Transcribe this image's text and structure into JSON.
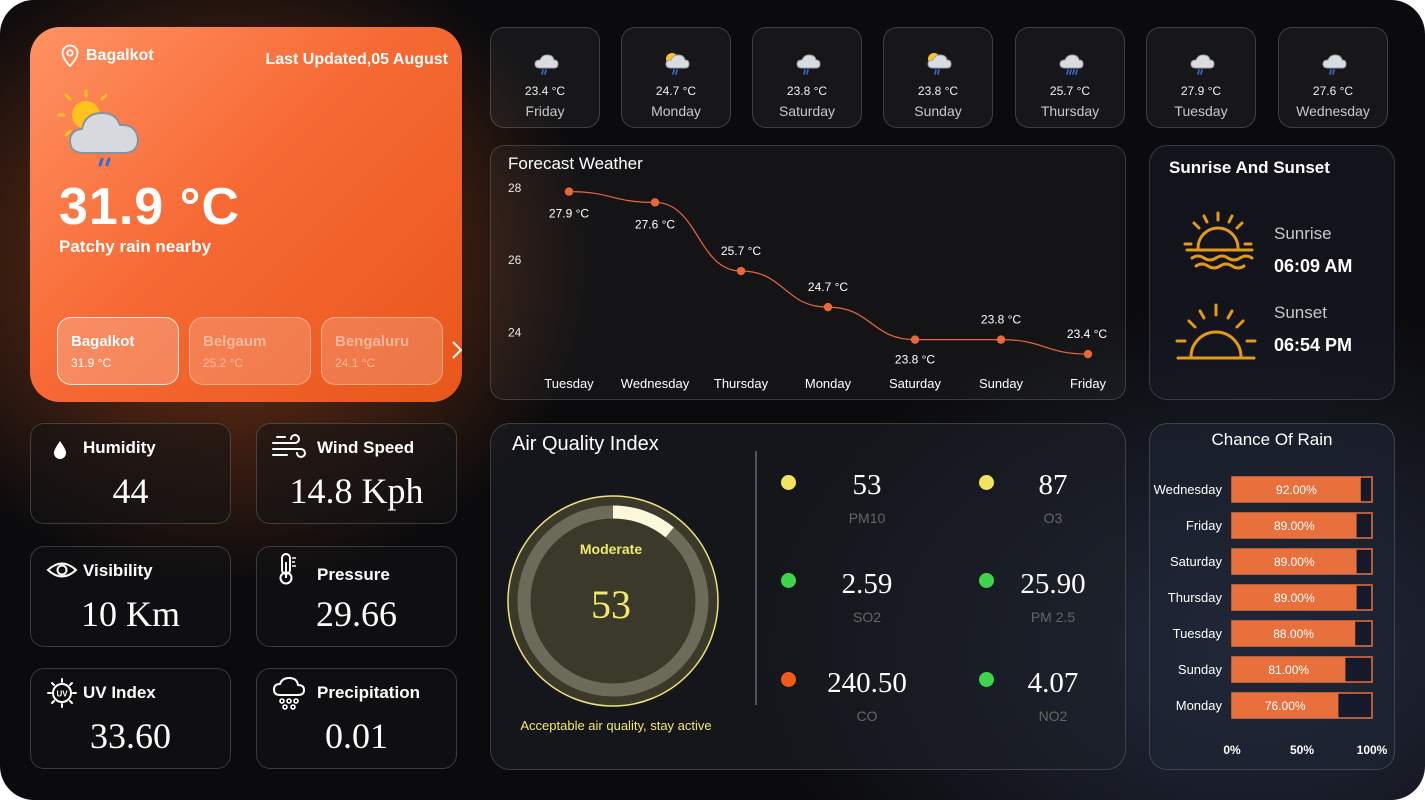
{
  "main": {
    "location": "Bagalkot",
    "last_updated": "Last Updated,05 August",
    "temperature": "31.9 °C",
    "condition": "Patchy rain nearby",
    "cities": [
      {
        "name": "Bagalkot",
        "temp": "31.9 °C"
      },
      {
        "name": "Belgaum",
        "temp": "25.2 °C"
      },
      {
        "name": "Bengaluru",
        "temp": "24.1 °C"
      }
    ],
    "next_icon": "chevron-right-icon"
  },
  "days": [
    {
      "temp": "23.4 °C",
      "day": "Friday",
      "icon": "rain-cloud-icon"
    },
    {
      "temp": "24.7 °C",
      "day": "Monday",
      "icon": "sun-rain-cloud-icon"
    },
    {
      "temp": "23.8 °C",
      "day": "Saturday",
      "icon": "rain-cloud-icon"
    },
    {
      "temp": "23.8 °C",
      "day": "Sunday",
      "icon": "sun-rain-cloud-icon"
    },
    {
      "temp": "25.7 °C",
      "day": "Thursday",
      "icon": "heavy-rain-cloud-icon"
    },
    {
      "temp": "27.9 °C",
      "day": "Tuesday",
      "icon": "rain-cloud-icon"
    },
    {
      "temp": "27.6 °C",
      "day": "Wednesday",
      "icon": "rain-cloud-icon"
    }
  ],
  "stats": [
    {
      "label": "Humidity",
      "value": "44",
      "icon": "droplet-icon"
    },
    {
      "label": "Wind Speed",
      "value": "14.8 Kph",
      "icon": "wind-icon"
    },
    {
      "label": "Visibility",
      "value": "10 Km",
      "icon": "eye-icon"
    },
    {
      "label": "Pressure",
      "value": "29.66",
      "icon": "thermometer-icon"
    },
    {
      "label": "UV Index",
      "value": "33.60",
      "icon": "uv-sun-icon"
    },
    {
      "label": "Precipitation",
      "value": "0.01",
      "icon": "cloud-rain-icon"
    }
  ],
  "forecast": {
    "title": "Forecast Weather",
    "chart_data": {
      "type": "line",
      "x": [
        "Tuesday",
        "Wednesday",
        "Thursday",
        "Monday",
        "Saturday",
        "Sunday",
        "Friday"
      ],
      "values": [
        27.9,
        27.6,
        25.7,
        24.7,
        23.8,
        23.8,
        23.4
      ],
      "data_labels": [
        "27.9 °C",
        "27.6 °C",
        "25.7 °C",
        "24.7 °C",
        "23.8 °C",
        "23.8 °C",
        "23.4 °C"
      ],
      "y_ticks": [
        "28",
        "26",
        "24"
      ],
      "ylim": [
        23.4,
        28
      ],
      "color": "#e8683a"
    }
  },
  "sun": {
    "title": "Sunrise And Sunset",
    "sunrise_label": "Sunrise",
    "sunrise_time": "06:09 AM",
    "sunset_label": "Sunset",
    "sunset_time": "06:54 PM",
    "color": "#e49a18"
  },
  "aqi": {
    "title": "Air Quality Index",
    "status": "Moderate",
    "value": "53",
    "level_fraction": 0.11,
    "note": "Acceptable air quality, stay active",
    "items": [
      {
        "value": "53",
        "label": "PM10",
        "color": "#f2e35e"
      },
      {
        "value": "87",
        "label": "O3",
        "color": "#f2e35e"
      },
      {
        "value": "2.59",
        "label": "SO2",
        "color": "#3fd44a"
      },
      {
        "value": "25.90",
        "label": "PM 2.5",
        "color": "#3fd44a"
      },
      {
        "value": "240.50",
        "label": "CO",
        "color": "#f05a1a"
      },
      {
        "value": "4.07",
        "label": "NO2",
        "color": "#3fd44a"
      }
    ]
  },
  "rain": {
    "title": "Chance Of Rain",
    "chart_data": {
      "type": "bar",
      "categories": [
        "Wednesday",
        "Friday",
        "Saturday",
        "Thursday",
        "Tuesday",
        "Sunday",
        "Monday"
      ],
      "values": [
        92.0,
        89.0,
        89.0,
        89.0,
        88.0,
        81.0,
        76.0
      ],
      "data_labels": [
        "92.00%",
        "89.00%",
        "89.00%",
        "89.00%",
        "88.00%",
        "81.00%",
        "76.00%"
      ],
      "x_ticks": [
        "0%",
        "50%",
        "100%"
      ],
      "xlim": [
        0,
        100
      ],
      "color": "#e8703c"
    }
  }
}
